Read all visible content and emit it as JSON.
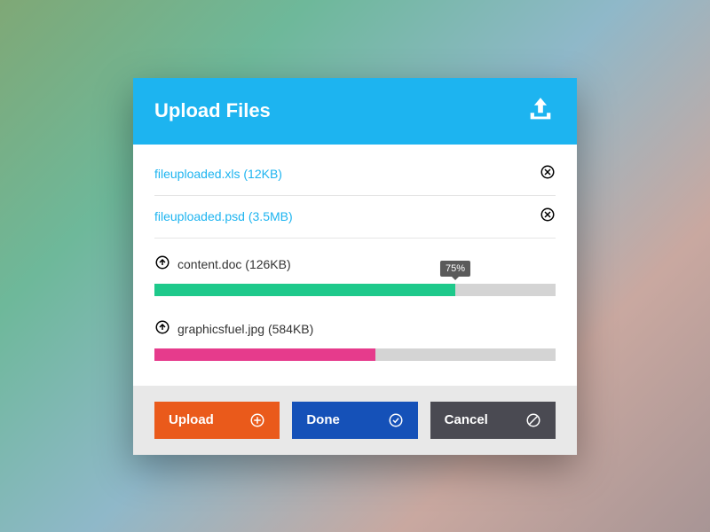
{
  "header": {
    "title": "Upload Files"
  },
  "completed": [
    {
      "label": "fileuploaded.xls (12KB)"
    },
    {
      "label": "fileuploaded.psd (3.5MB)"
    }
  ],
  "uploading": [
    {
      "label": "content.doc (126KB)",
      "percent": 75,
      "percent_label": "75%",
      "color": "green"
    },
    {
      "label": "graphicsfuel.jpg  (584KB)",
      "percent": 55,
      "color": "pink"
    }
  ],
  "buttons": {
    "upload": "Upload",
    "done": "Done",
    "cancel": "Cancel"
  }
}
